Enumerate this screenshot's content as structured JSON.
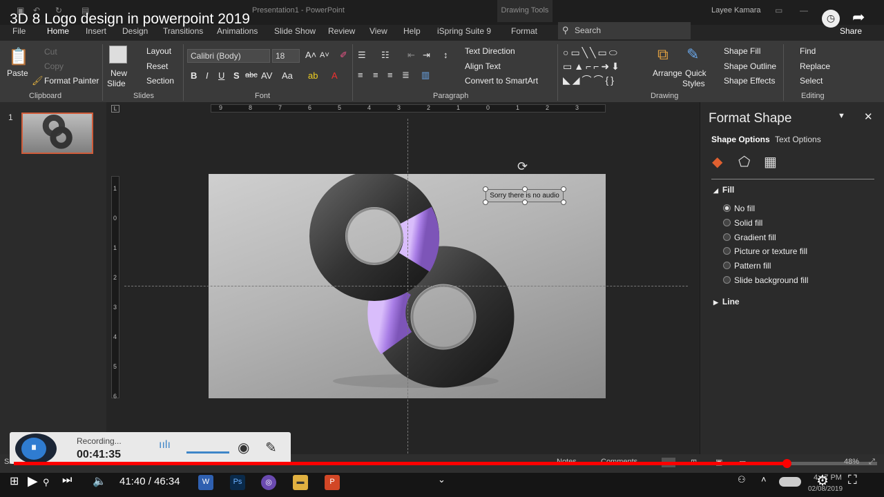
{
  "video": {
    "title": "3D 8 Logo design in powerpoint 2019",
    "share": "Share",
    "time_current": "41:40",
    "time_separator": "/",
    "time_total": "46:34",
    "progress_fraction": 0.895
  },
  "app": {
    "title": "Presentation1  -  PowerPoint",
    "contextual": "Drawing Tools",
    "user": "Layee Kamara",
    "search_placeholder": "Search"
  },
  "tabs": [
    "File",
    "Home",
    "Insert",
    "Design",
    "Transitions",
    "Animations",
    "Slide Show",
    "Review",
    "View",
    "Help",
    "iSpring Suite 9",
    "Format"
  ],
  "active_tab": "Home",
  "ribbon": {
    "clipboard": {
      "label": "Clipboard",
      "paste": "Paste",
      "cut": "Cut",
      "copy": "Copy",
      "format_painter": "Format Painter"
    },
    "slides": {
      "label": "Slides",
      "new_slide": "New",
      "new_slide_2": "Slide",
      "layout": "Layout",
      "reset": "Reset",
      "section": "Section"
    },
    "font": {
      "label": "Font",
      "name": "Calibri (Body)",
      "size": "18"
    },
    "paragraph": {
      "label": "Paragraph",
      "text_direction": "Text Direction",
      "align_text": "Align Text",
      "smartart": "Convert to SmartArt"
    },
    "drawing": {
      "label": "Drawing",
      "arrange": "Arrange",
      "quick_styles": "Quick",
      "quick_styles_2": "Styles",
      "fill": "Shape Fill",
      "outline": "Shape Outline",
      "effects": "Shape Effects"
    },
    "editing": {
      "label": "Editing",
      "find": "Find",
      "replace": "Replace",
      "select": "Select"
    }
  },
  "slides": {
    "thumb_number": "1"
  },
  "rulers": {
    "h": [
      "9",
      "8",
      "7",
      "6",
      "5",
      "4",
      "3",
      "2",
      "1",
      "0",
      "1",
      "2",
      "3"
    ],
    "v": [
      "1",
      "0",
      "1",
      "2",
      "3",
      "4",
      "5",
      "6"
    ]
  },
  "slide": {
    "textbox": "Sorry there is no audio"
  },
  "pane": {
    "title": "Format Shape",
    "tab_shape": "Shape Options",
    "tab_text": "Text Options",
    "section_fill": "Fill",
    "section_line": "Line",
    "fill_options": [
      "No fill",
      "Solid fill",
      "Gradient fill",
      "Picture or texture fill",
      "Pattern fill",
      "Slide background fill"
    ],
    "selected": "No fill"
  },
  "status": {
    "slide_abbr": "Sl",
    "notes": "Notes",
    "comments": "Comments",
    "zoom": "48%"
  },
  "recorder": {
    "status": "Recording...",
    "elapsed": "00:41:35"
  },
  "taskbar": {
    "time": "4:47 PM",
    "date": "02/08/2019"
  },
  "colors": {
    "accent": "#d05c3a",
    "progress": "#ff0000",
    "logo_dark": "#3a3a3a",
    "logo_purple": "#a97ee6",
    "recorder_blue": "#2f7cd1"
  }
}
